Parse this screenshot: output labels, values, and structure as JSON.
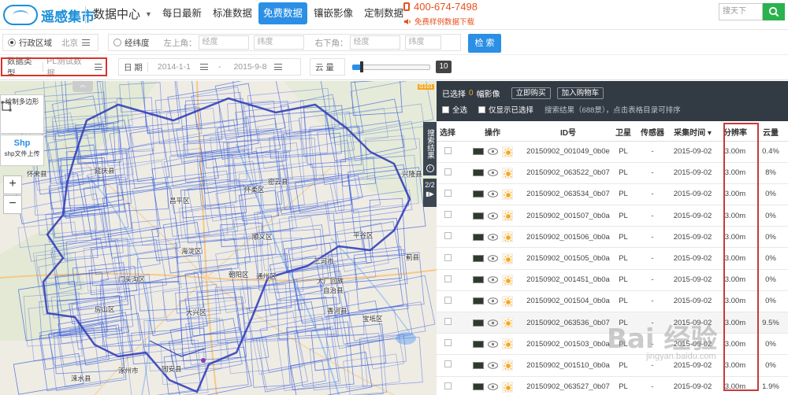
{
  "brand": {
    "name": "遥感集市"
  },
  "header": {
    "section": "数据中心",
    "tabs": [
      {
        "label": "每日最新"
      },
      {
        "label": "标准数据"
      },
      {
        "label": "免费数据"
      },
      {
        "label": "镶嵌影像"
      },
      {
        "label": "定制数据"
      }
    ],
    "active_tab": "免费数据",
    "hotline": "400-674-7498",
    "sample_link": "免费样例数据下载",
    "search_placeholder": "搜天下"
  },
  "filters": {
    "region_label": "行政区域",
    "region_value": "北京",
    "latlng_label": "经纬度",
    "top_left_label": "左上角：",
    "bottom_right_label": "右下角：",
    "lng_placeholder": "经度",
    "lat_placeholder": "纬度",
    "search_button": "检 索",
    "data_type_label": "数据类型",
    "data_type_value": "PL测试数据",
    "date_label": "日 期",
    "date_from": "2014-1-1",
    "date_sep": "-",
    "date_to": "2015-9-8",
    "cloud_label": "云 量",
    "cloud_value": "10",
    "cloud_fraction": 0.12
  },
  "map": {
    "tools": {
      "polygon": "绘制多边形",
      "shp_title": "Shp",
      "shp": "shp文件上传"
    },
    "zoom_in": "+",
    "zoom_out": "−",
    "side_tab": "搜索结果",
    "side_page": "2/2",
    "labels": [
      "怀来县",
      "延庆县",
      "怀柔区",
      "密云县",
      "兴隆县",
      "昌平区",
      "顺义区",
      "平谷区",
      "三河市",
      "蓟县",
      "门头沟区",
      "海淀区",
      "朝阳区",
      "通州区",
      "大厂回族",
      "自治县",
      "香河县",
      "房山区",
      "大兴区",
      "宝坻区",
      "涿州市",
      "固安县",
      "涞水县",
      "G101"
    ]
  },
  "results": {
    "selected_prefix": "已选择",
    "selected_count": "0",
    "selected_suffix": "幅影像",
    "buy_button": "立即购买",
    "cart_button": "加入购物车",
    "select_all": "全选",
    "only_selected": "仅显示已选择",
    "hint": "搜索结果（688景），点击表格目录可排序",
    "columns": [
      "选择",
      "操作",
      "ID号",
      "卫星",
      "传感器",
      "采集时间 ▾",
      "分辨率",
      "云量"
    ],
    "rows": [
      {
        "id": "20150902_001049_0b0e",
        "sat": "PL",
        "sensor": "-",
        "date": "2015-09-02",
        "res": "3.00m",
        "cloud": "0.4%"
      },
      {
        "id": "20150902_063522_0b07",
        "sat": "PL",
        "sensor": "-",
        "date": "2015-09-02",
        "res": "3.00m",
        "cloud": "8%"
      },
      {
        "id": "20150902_063534_0b07",
        "sat": "PL",
        "sensor": "-",
        "date": "2015-09-02",
        "res": "3.00m",
        "cloud": "0%"
      },
      {
        "id": "20150902_001507_0b0a",
        "sat": "PL",
        "sensor": "-",
        "date": "2015-09-02",
        "res": "3.00m",
        "cloud": "0%"
      },
      {
        "id": "20150902_001506_0b0a",
        "sat": "PL",
        "sensor": "-",
        "date": "2015-09-02",
        "res": "3.00m",
        "cloud": "0%"
      },
      {
        "id": "20150902_001505_0b0a",
        "sat": "PL",
        "sensor": "-",
        "date": "2015-09-02",
        "res": "3.00m",
        "cloud": "0%"
      },
      {
        "id": "20150902_001451_0b0a",
        "sat": "PL",
        "sensor": "-",
        "date": "2015-09-02",
        "res": "3.00m",
        "cloud": "0%"
      },
      {
        "id": "20150902_001504_0b0a",
        "sat": "PL",
        "sensor": "-",
        "date": "2015-09-02",
        "res": "3.00m",
        "cloud": "0%"
      },
      {
        "id": "20150902_063536_0b07",
        "sat": "PL",
        "sensor": "-",
        "date": "2015-09-02",
        "res": "3.00m",
        "cloud": "9.5%"
      },
      {
        "id": "20150902_001503_0b0a",
        "sat": "PL",
        "sensor": "-",
        "date": "2015-09-02",
        "res": "3.00m",
        "cloud": "0%"
      },
      {
        "id": "20150902_001510_0b0a",
        "sat": "PL",
        "sensor": "-",
        "date": "2015-09-02",
        "res": "3.00m",
        "cloud": "0%"
      },
      {
        "id": "20150902_063527_0b07",
        "sat": "PL",
        "sensor": "-",
        "date": "2015-09-02",
        "res": "3.00m",
        "cloud": "1.9%"
      }
    ]
  },
  "watermark": {
    "main": "Bai 经验",
    "sub": "jingyan.baidu.com"
  },
  "colors": {
    "accent": "#2b8fe5",
    "hotline": "#e8501d",
    "highlight": "#d9342b",
    "footprint": "#3a5fd9",
    "search_green": "#2ab24f"
  }
}
